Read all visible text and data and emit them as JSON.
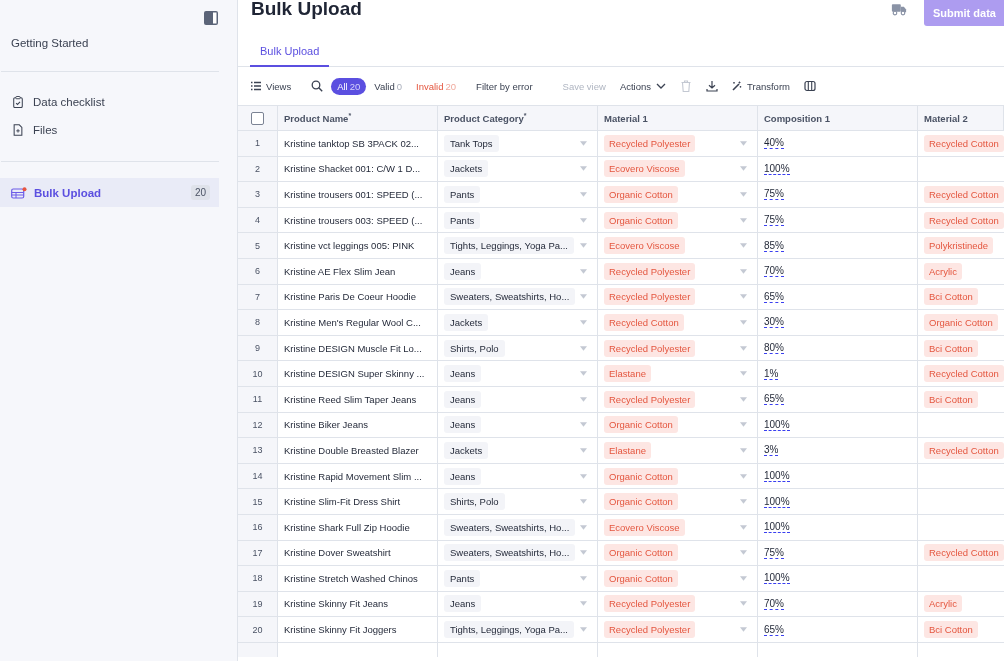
{
  "sidebar": {
    "heading": "Getting Started",
    "items": [
      {
        "label": "Data checklist",
        "kind": "checklist",
        "selected": false
      },
      {
        "label": "Files",
        "kind": "files",
        "selected": false
      }
    ],
    "uploads": [
      {
        "label": "Bulk Upload",
        "count": "20",
        "selected": true
      }
    ]
  },
  "header": {
    "title": "Bulk Upload",
    "submit": {
      "label": "Submit data",
      "disabled": true
    }
  },
  "tabs": [
    {
      "label": "Bulk Upload",
      "selected": true
    }
  ],
  "toolbar": {
    "views": "Views",
    "filters": [
      {
        "label": "All",
        "count": "20",
        "kind": "all",
        "selected": true
      },
      {
        "label": "Valid",
        "count": "0",
        "kind": "valid",
        "selected": false
      },
      {
        "label": "Invalid",
        "count": "20",
        "kind": "invalid",
        "selected": false
      }
    ],
    "filter_by_error": "Filter by error",
    "save_view": {
      "label": "Save view",
      "disabled": true
    },
    "actions": "Actions",
    "transform": "Transform"
  },
  "table": {
    "select_all": {
      "checked": false
    },
    "columns": [
      "Product Name$^{*}$",
      "Product Category$^{*}$",
      "Material 1",
      "Composition 1",
      "Material 2"
    ],
    "rows": [
      {
        "number": "1",
        "name": "Kristine tanktop SB 3PACK 02...",
        "category": "Tank Tops",
        "material_1": "Recycled Polyester",
        "composition_1": "40%",
        "material_2": "Recycled Cotton"
      },
      {
        "number": "2",
        "name": "Kristine Shacket 001: C/W 1 D...",
        "category": "Jackets",
        "material_1": "Ecovero Viscose",
        "composition_1": "100%"
      },
      {
        "number": "3",
        "name": "Kristine trousers 001: SPEED (...",
        "category": "Pants",
        "material_1": "Organic Cotton",
        "composition_1": "75%",
        "material_2": "Recycled Cotton"
      },
      {
        "number": "4",
        "name": "Kristine trousers 003: SPEED (...",
        "category": "Pants",
        "material_1": "Organic Cotton",
        "composition_1": "75%",
        "material_2": "Recycled Cotton"
      },
      {
        "number": "5",
        "name": "Kristine vct leggings 005: PINK",
        "category": "Tights, Leggings, Yoga Pa...",
        "material_1": "Ecovero Viscose",
        "composition_1": "85%",
        "material_2": "Polykristinede"
      },
      {
        "number": "6",
        "name": "Kristine AE Flex Slim Jean",
        "category": "Jeans",
        "material_1": "Recycled Polyester",
        "composition_1": "70%",
        "material_2": "Acrylic"
      },
      {
        "number": "7",
        "name": "Kristine Paris De Coeur Hoodie",
        "category": "Sweaters, Sweatshirts, Ho...",
        "material_1": "Recycled Polyester",
        "composition_1": "65%",
        "material_2": "Bci Cotton"
      },
      {
        "number": "8",
        "name": "Kristine Men's Regular Wool C...",
        "category": "Jackets",
        "material_1": "Recycled Cotton",
        "composition_1": "30%",
        "material_2": "Organic Cotton"
      },
      {
        "number": "9",
        "name": "Kristine DESIGN Muscle Fit Lo...",
        "category": "Shirts, Polo",
        "material_1": "Recycled Polyester",
        "composition_1": "80%",
        "material_2": "Bci Cotton"
      },
      {
        "number": "10",
        "name": "Kristine DESIGN Super Skinny ...",
        "category": "Jeans",
        "material_1": "Elastane",
        "composition_1": "1%",
        "material_2": "Recycled Cotton"
      },
      {
        "number": "11",
        "name": "Kristine Reed Slim Taper Jeans",
        "category": "Jeans",
        "material_1": "Recycled Polyester",
        "composition_1": "65%",
        "material_2": "Bci Cotton"
      },
      {
        "number": "12",
        "name": "Kristine Biker Jeans",
        "category": "Jeans",
        "material_1": "Organic Cotton",
        "composition_1": "100%"
      },
      {
        "number": "13",
        "name": "Kristine Double Breasted Blazer",
        "category": "Jackets",
        "material_1": "Elastane",
        "composition_1": "3%",
        "material_2": "Recycled Cotton"
      },
      {
        "number": "14",
        "name": "Kristine Rapid Movement Slim ...",
        "category": "Jeans",
        "material_1": "Organic Cotton",
        "composition_1": "100%"
      },
      {
        "number": "15",
        "name": "Kristine Slim-Fit Dress Shirt",
        "category": "Shirts, Polo",
        "material_1": "Organic Cotton",
        "composition_1": "100%"
      },
      {
        "number": "16",
        "name": "Kristine Shark Full Zip Hoodie",
        "category": "Sweaters, Sweatshirts, Ho...",
        "material_1": "Ecovero Viscose",
        "composition_1": "100%"
      },
      {
        "number": "17",
        "name": "Kristine Dover Sweatshirt",
        "category": "Sweaters, Sweatshirts, Ho...",
        "material_1": "Organic Cotton",
        "composition_1": "75%",
        "material_2": "Recycled Cotton"
      },
      {
        "number": "18",
        "name": "Kristine Stretch Washed Chinos",
        "category": "Pants",
        "material_1": "Organic Cotton",
        "composition_1": "100%"
      },
      {
        "number": "19",
        "name": "Kristine Skinny Fit Jeans",
        "category": "Jeans",
        "material_1": "Recycled Polyester",
        "composition_1": "70%",
        "material_2": "Acrylic"
      },
      {
        "number": "20",
        "name": "Kristine Skinny Fit Joggers",
        "category": "Tights, Leggings, Yoga Pa...",
        "material_1": "Recycled Polyester",
        "composition_1": "65%",
        "material_2": "Bci Cotton"
      }
    ]
  }
}
